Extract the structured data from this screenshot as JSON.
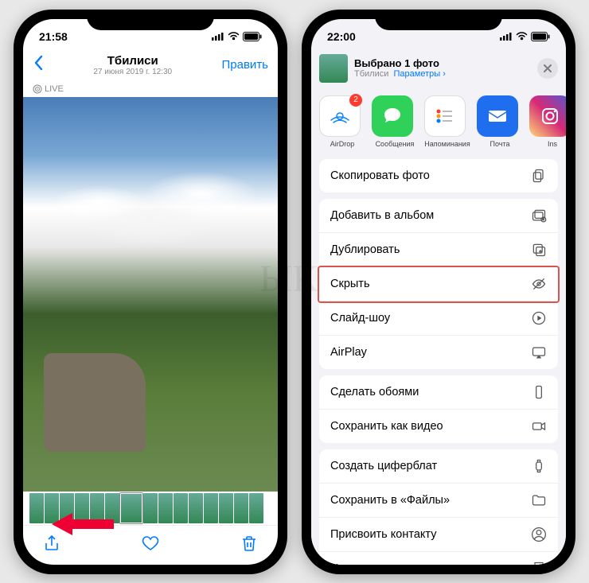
{
  "left": {
    "time": "21:58",
    "title": "Тбилиси",
    "subtitle": "27 июня 2019 г.  12:30",
    "edit": "Править",
    "live": "LIVE"
  },
  "right": {
    "time": "22:00",
    "selected_title": "Выбрано 1 фото",
    "selected_sub_loc": "Тбилиси",
    "selected_sub_params": "Параметры",
    "apps": {
      "airdrop": "AirDrop",
      "airdrop_badge": "2",
      "messages": "Сообщения",
      "reminders": "Напоминания",
      "mail": "Почта",
      "instagram": "Ins"
    },
    "actions": {
      "copy": "Скопировать фото",
      "add_album": "Добавить в альбом",
      "duplicate": "Дублировать",
      "hide": "Скрыть",
      "slideshow": "Слайд-шоу",
      "airplay": "AirPlay",
      "wallpaper": "Сделать обоями",
      "save_video": "Сохранить как видео",
      "watchface": "Создать циферблат",
      "save_files": "Сохранить в «Файлы»",
      "assign_contact": "Присвоить контакту",
      "print": "Напечатать"
    }
  },
  "watermark": "ЫК"
}
